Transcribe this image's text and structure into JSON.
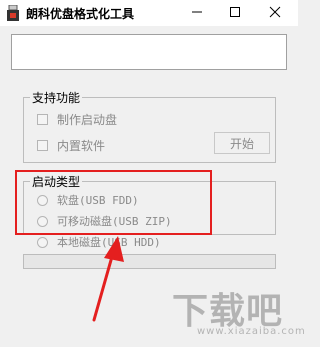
{
  "window": {
    "title": "朗科优盘格式化工具",
    "controls": {
      "minimize": "—",
      "maximize": "☐",
      "close": "✕"
    }
  },
  "support_group": {
    "legend": "支持功能",
    "options": [
      {
        "label": "制作启动盘",
        "checked": false,
        "enabled": false
      },
      {
        "label": "内置软件",
        "checked": false,
        "enabled": false
      }
    ],
    "start_button": "开始"
  },
  "boot_type_group": {
    "legend": "启动类型",
    "options": [
      {
        "label": "软盘(USB FDD)",
        "selected": false,
        "enabled": false
      },
      {
        "label": "可移动磁盘(USB ZIP)",
        "selected": false,
        "enabled": false
      },
      {
        "label": "本地磁盘(USB HDD)",
        "selected": false,
        "enabled": false
      }
    ]
  },
  "progress": {
    "value": 0
  },
  "annotation": {
    "highlight_color": "#e41f1f"
  },
  "watermark": {
    "logo_text": "下载吧",
    "sub_text": "www.xiazaiba.com"
  }
}
